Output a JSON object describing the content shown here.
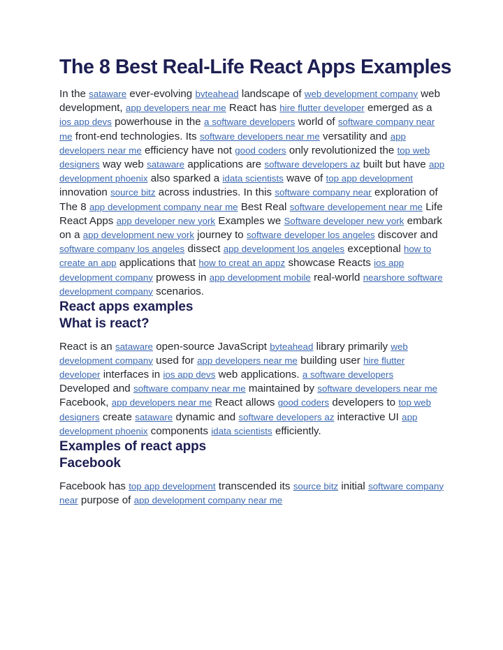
{
  "document": {
    "title": "The 8 Best Real-Life React Apps Examples",
    "headings": {
      "react_apps_examples": "React apps examples",
      "what_is_react": "What is react?",
      "examples_of_react_apps": "Examples of react apps",
      "facebook": "Facebook"
    },
    "colors": {
      "heading": "#1d1f53",
      "body_text": "#23262c",
      "link": "#3b68b0",
      "page_background": "#ffffff"
    },
    "paragraph_1": [
      {
        "type": "text",
        "value": "In the "
      },
      {
        "type": "link",
        "value": "sataware"
      },
      {
        "type": "text",
        "value": " ever-evolving "
      },
      {
        "type": "link",
        "value": "byteahead"
      },
      {
        "type": "text",
        "value": " landscape of "
      },
      {
        "type": "link",
        "value": "web development company"
      },
      {
        "type": "text",
        "value": " web development, "
      },
      {
        "type": "link",
        "value": "app developers near me"
      },
      {
        "type": "text",
        "value": " React has "
      },
      {
        "type": "link",
        "value": "hire flutter developer"
      },
      {
        "type": "text",
        "value": " emerged as a "
      },
      {
        "type": "link",
        "value": "ios app devs"
      },
      {
        "type": "text",
        "value": " powerhouse in the "
      },
      {
        "type": "link",
        "value": "a software developers"
      },
      {
        "type": "text",
        "value": " world of "
      },
      {
        "type": "link",
        "value": "software company near me"
      },
      {
        "type": "text",
        "value": " front-end technologies. Its "
      },
      {
        "type": "link",
        "value": "software developers near me"
      },
      {
        "type": "text",
        "value": " versatility and "
      },
      {
        "type": "link",
        "value": "app developers near me"
      },
      {
        "type": "text",
        "value": " efficiency have not "
      },
      {
        "type": "link",
        "value": "good coders"
      },
      {
        "type": "text",
        "value": " only revolutionized the  "
      },
      {
        "type": "link",
        "value": "top web designers"
      },
      {
        "type": "text",
        "value": " way web "
      },
      {
        "type": "link",
        "value": "sataware"
      },
      {
        "type": "text",
        "value": " applications are "
      },
      {
        "type": "link",
        "value": "software developers az"
      },
      {
        "type": "text",
        "value": " built but have  "
      },
      {
        "type": "link",
        "value": "app development phoenix"
      },
      {
        "type": "text",
        "value": " also sparked a "
      },
      {
        "type": "link",
        "value": "idata scientists"
      },
      {
        "type": "text",
        "value": " wave of "
      },
      {
        "type": "link",
        "value": "top app development"
      },
      {
        "type": "text",
        "value": " innovation "
      },
      {
        "type": "link",
        "value": "source bitz"
      },
      {
        "type": "text",
        "value": " across industries. In this "
      },
      {
        "type": "link",
        "value": "software company near"
      },
      {
        "type": "text",
        "value": " exploration of  The 8 "
      },
      {
        "type": "link",
        "value": "app development company near me"
      },
      {
        "type": "text",
        "value": " Best Real "
      },
      {
        "type": "link",
        "value": "software developement near me"
      },
      {
        "type": "text",
        "value": " Life React Apps "
      },
      {
        "type": "link",
        "value": "app developer new york"
      },
      {
        "type": "text",
        "value": " Examples we "
      },
      {
        "type": "link",
        "value": "Software developer new york"
      },
      {
        "type": "text",
        "value": " embark on a "
      },
      {
        "type": "link",
        "value": "app development new york"
      },
      {
        "type": "text",
        "value": " journey to "
      },
      {
        "type": "link",
        "value": "software developer los angeles"
      },
      {
        "type": "text",
        "value": " discover and "
      },
      {
        "type": "link",
        "value": "software company los angeles"
      },
      {
        "type": "text",
        "value": " dissect "
      },
      {
        "type": "link",
        "value": "app development los angeles"
      },
      {
        "type": "text",
        "value": " exceptional "
      },
      {
        "type": "link",
        "value": "how to create an app"
      },
      {
        "type": "text",
        "value": " applications that "
      },
      {
        "type": "link",
        "value": "how to creat an appz"
      },
      {
        "type": "text",
        "value": " showcase Reacts "
      },
      {
        "type": "link",
        "value": "ios app development company"
      },
      {
        "type": "text",
        "value": " prowess in "
      },
      {
        "type": "link",
        "value": "app development mobile"
      },
      {
        "type": "text",
        "value": " real-world "
      },
      {
        "type": "link",
        "value": "nearshore software development company"
      },
      {
        "type": "text",
        "value": " scenarios."
      }
    ],
    "paragraph_2": [
      {
        "type": "text",
        "value": "React is an "
      },
      {
        "type": "link",
        "value": "sataware"
      },
      {
        "type": "text",
        "value": " open-source JavaScript "
      },
      {
        "type": "link",
        "value": "byteahead"
      },
      {
        "type": "text",
        "value": " library primarily "
      },
      {
        "type": "link",
        "value": "web development company"
      },
      {
        "type": "text",
        "value": " used for "
      },
      {
        "type": "link",
        "value": "app developers near me"
      },
      {
        "type": "text",
        "value": " building user "
      },
      {
        "type": "link",
        "value": "hire flutter developer"
      },
      {
        "type": "text",
        "value": " interfaces in "
      },
      {
        "type": "link",
        "value": "ios app devs"
      },
      {
        "type": "text",
        "value": " web applications. "
      },
      {
        "type": "link",
        "value": "a software developers"
      },
      {
        "type": "text",
        "value": " Developed and "
      },
      {
        "type": "link",
        "value": "software company near me"
      },
      {
        "type": "text",
        "value": " maintained by "
      },
      {
        "type": "link",
        "value": "software developers near me"
      },
      {
        "type": "text",
        "value": " Facebook, "
      },
      {
        "type": "link",
        "value": "app developers near me"
      },
      {
        "type": "text",
        "value": " React allows "
      },
      {
        "type": "link",
        "value": "good coders"
      },
      {
        "type": "text",
        "value": " developers to "
      },
      {
        "type": "link",
        "value": "top web designers"
      },
      {
        "type": "text",
        "value": " create "
      },
      {
        "type": "link",
        "value": "sataware"
      },
      {
        "type": "text",
        "value": " dynamic and "
      },
      {
        "type": "link",
        "value": "software developers az"
      },
      {
        "type": "text",
        "value": " interactive UI  "
      },
      {
        "type": "link",
        "value": "app development phoenix"
      },
      {
        "type": "text",
        "value": " components "
      },
      {
        "type": "link",
        "value": "idata scientists"
      },
      {
        "type": "text",
        "value": " efficiently."
      }
    ],
    "paragraph_3": [
      {
        "type": "text",
        "value": "Facebook has "
      },
      {
        "type": "link",
        "value": "top app development"
      },
      {
        "type": "text",
        "value": " transcended its "
      },
      {
        "type": "link",
        "value": "source bitz"
      },
      {
        "type": "text",
        "value": " initial "
      },
      {
        "type": "link",
        "value": "software company near"
      },
      {
        "type": "text",
        "value": " purpose of "
      },
      {
        "type": "link",
        "value": "app development company near me"
      }
    ]
  }
}
